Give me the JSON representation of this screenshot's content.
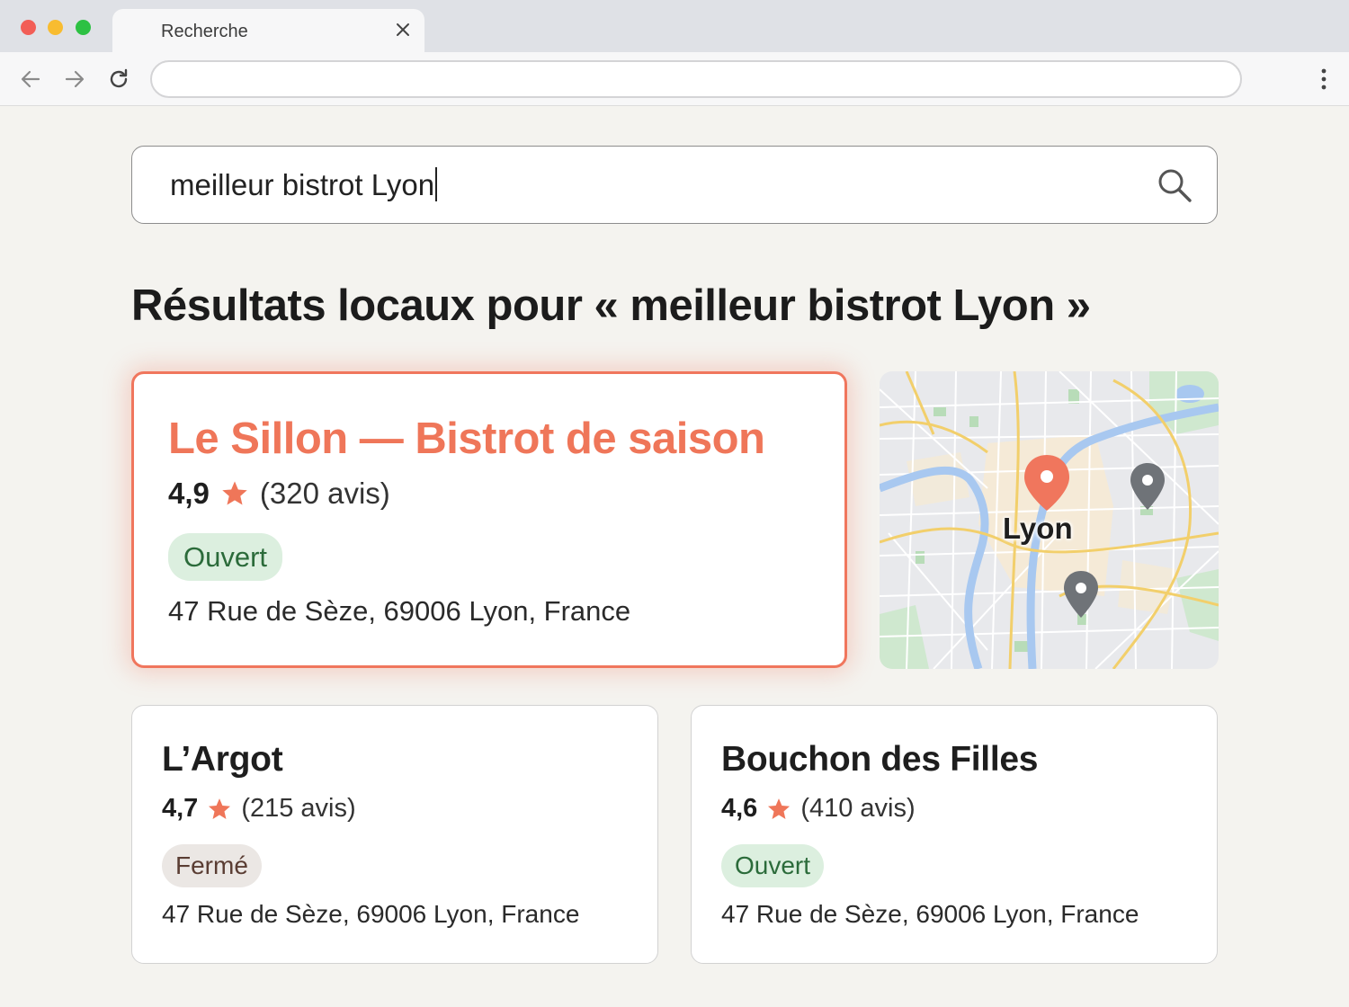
{
  "browser": {
    "tab_title": "Recherche",
    "address_bar_value": ""
  },
  "search": {
    "query": "meilleur bistrot Lyon"
  },
  "results_heading": "Résultats locaux pour « meilleur bistrot Lyon »",
  "featured": {
    "name": "Le Sillon — Bistrot de saison",
    "rating": "4,9",
    "reviews": "(320 avis)",
    "status": "Ouvert",
    "address": "47 Rue de Sèze, 69006 Lyon, France"
  },
  "results": [
    {
      "name": "L’Argot",
      "rating": "4,7",
      "reviews": "(215 avis)",
      "status": "Fermé",
      "address": "47 Rue de Sèze, 69006 Lyon, France"
    },
    {
      "name": "Bouchon des Filles",
      "rating": "4,6",
      "reviews": "(410 avis)",
      "status": "Ouvert",
      "address": "47 Rue de Sèze, 69006 Lyon, France"
    }
  ],
  "map": {
    "city_label": "Lyon"
  },
  "icons": {
    "star": "star-icon",
    "search": "search-icon",
    "selected_pin": "map-pin-selected-icon",
    "pin": "map-pin-icon"
  },
  "colors": {
    "accent": "#ef7659",
    "open_bg": "#dcefdf",
    "open_text": "#2b6b3a",
    "closed_bg": "#ebe7e4",
    "closed_text": "#5a3d33",
    "page_bg": "#f4f3ef"
  }
}
